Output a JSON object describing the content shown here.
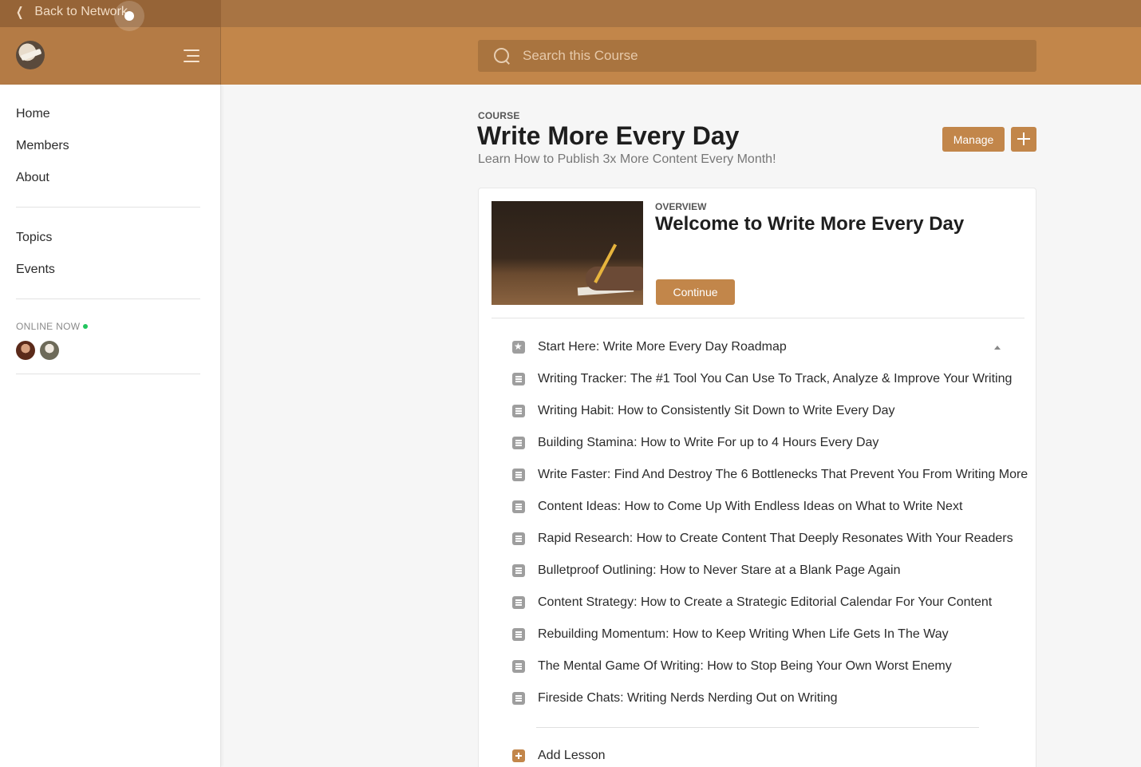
{
  "header": {
    "back_label": "Back to Network",
    "search_placeholder": "Search this Course"
  },
  "sidebar": {
    "nav_main": [
      "Home",
      "Members",
      "About"
    ],
    "nav_secondary": [
      "Topics",
      "Events"
    ],
    "online_label": "ONLINE NOW"
  },
  "course": {
    "label": "COURSE",
    "title": "Write More Every Day",
    "subtitle": "Learn How to Publish 3x More Content Every Month!",
    "manage_label": "Manage"
  },
  "overview": {
    "label": "OVERVIEW",
    "title": "Welcome to Write More Every Day",
    "continue_label": "Continue"
  },
  "lessons": [
    {
      "title": "Start Here: Write More Every Day Roadmap",
      "icon": "star-icon"
    },
    {
      "title": "Writing Tracker: The #1 Tool You Can Use To Track, Analyze & Improve Your Writing",
      "icon": "list-icon"
    },
    {
      "title": "Writing Habit: How to Consistently Sit Down to Write Every Day",
      "icon": "list-icon"
    },
    {
      "title": "Building Stamina: How to Write For up to 4 Hours Every Day",
      "icon": "list-icon"
    },
    {
      "title": "Write Faster: Find And Destroy The 6 Bottlenecks That Prevent You From Writing More",
      "icon": "list-icon"
    },
    {
      "title": "Content Ideas: How to Come Up With Endless Ideas on What to Write Next",
      "icon": "list-icon"
    },
    {
      "title": "Rapid Research: How to Create Content That Deeply Resonates With Your Readers",
      "icon": "list-icon"
    },
    {
      "title": "Bulletproof Outlining: How to Never Stare at a Blank Page Again",
      "icon": "list-icon"
    },
    {
      "title": "Content Strategy: How to Create a Strategic Editorial Calendar For Your Content",
      "icon": "list-icon"
    },
    {
      "title": "Rebuilding Momentum: How to Keep Writing When Life Gets In The Way",
      "icon": "list-icon"
    },
    {
      "title": "The Mental Game Of Writing: How to Stop Being Your Own Worst Enemy",
      "icon": "list-icon"
    },
    {
      "title": "Fireside Chats: Writing Nerds Nerding Out on Writing",
      "icon": "list-icon"
    }
  ],
  "add_lesson_label": "Add Lesson",
  "colors": {
    "brand": "#c2864a",
    "online": "#22c55e"
  }
}
